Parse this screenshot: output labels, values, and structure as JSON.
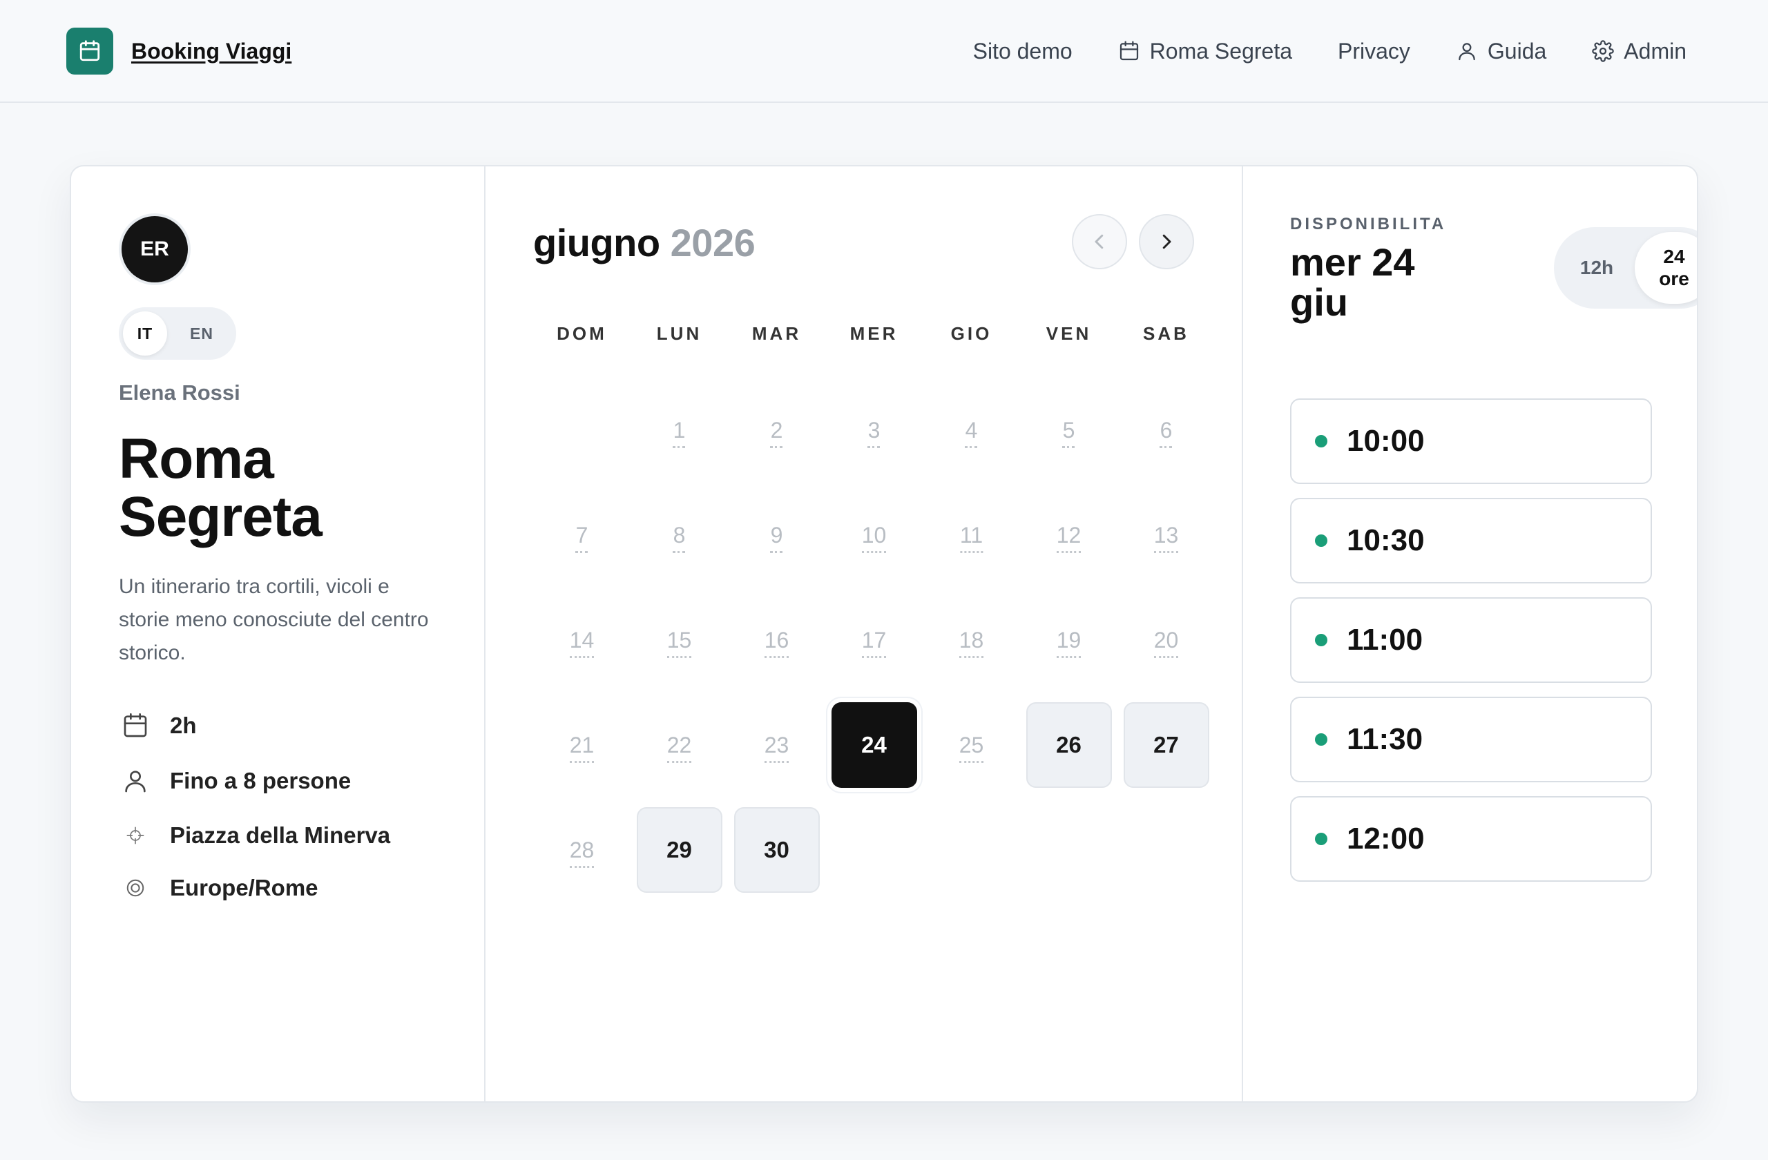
{
  "header": {
    "brand": "Booking Viaggi",
    "nav": [
      {
        "label": "Sito demo",
        "icon": ""
      },
      {
        "label": "Roma Segreta",
        "icon": "calendar-icon"
      },
      {
        "label": "Privacy",
        "icon": ""
      },
      {
        "label": "Guida",
        "icon": "user-icon"
      },
      {
        "label": "Admin",
        "icon": "gear-icon"
      }
    ]
  },
  "profile": {
    "initials": "ER",
    "lang": {
      "active": "IT",
      "other": "EN"
    },
    "host": "Elena Rossi",
    "title": "Roma Segreta",
    "description": "Un itinerario tra cortili, vicoli e storie meno conosciute del centro storico.",
    "meta": {
      "duration": "2h",
      "capacity": "Fino a 8 persone",
      "location": "Piazza della Minerva",
      "timezone": "Europe/Rome"
    }
  },
  "calendar": {
    "month": "giugno",
    "year": "2026",
    "weekdays": [
      "DOM",
      "LUN",
      "MAR",
      "MER",
      "GIO",
      "VEN",
      "SAB"
    ],
    "leading_blanks": 1,
    "days": [
      {
        "d": "1",
        "state": "disabled"
      },
      {
        "d": "2",
        "state": "disabled"
      },
      {
        "d": "3",
        "state": "disabled"
      },
      {
        "d": "4",
        "state": "disabled"
      },
      {
        "d": "5",
        "state": "disabled"
      },
      {
        "d": "6",
        "state": "disabled"
      },
      {
        "d": "7",
        "state": "disabled"
      },
      {
        "d": "8",
        "state": "disabled"
      },
      {
        "d": "9",
        "state": "disabled"
      },
      {
        "d": "10",
        "state": "disabled"
      },
      {
        "d": "11",
        "state": "disabled"
      },
      {
        "d": "12",
        "state": "disabled"
      },
      {
        "d": "13",
        "state": "disabled"
      },
      {
        "d": "14",
        "state": "disabled"
      },
      {
        "d": "15",
        "state": "disabled"
      },
      {
        "d": "16",
        "state": "disabled"
      },
      {
        "d": "17",
        "state": "disabled"
      },
      {
        "d": "18",
        "state": "disabled"
      },
      {
        "d": "19",
        "state": "disabled"
      },
      {
        "d": "20",
        "state": "disabled"
      },
      {
        "d": "21",
        "state": "disabled"
      },
      {
        "d": "22",
        "state": "disabled"
      },
      {
        "d": "23",
        "state": "disabled"
      },
      {
        "d": "24",
        "state": "selected"
      },
      {
        "d": "25",
        "state": "disabled"
      },
      {
        "d": "26",
        "state": "available"
      },
      {
        "d": "27",
        "state": "available"
      },
      {
        "d": "28",
        "state": "disabled"
      },
      {
        "d": "29",
        "state": "available"
      },
      {
        "d": "30",
        "state": "available"
      }
    ]
  },
  "availability": {
    "label": "DISPONIBILITA",
    "date": "mer 24 giu",
    "format": {
      "h12": "12h",
      "h24": "24 ore",
      "active": "h24"
    },
    "slots": [
      "10:00",
      "10:30",
      "11:00",
      "11:30",
      "12:00"
    ]
  },
  "colors": {
    "accent": "#1a7f6e",
    "slot_dot": "#1a9e78",
    "selected_day": "#111111"
  }
}
